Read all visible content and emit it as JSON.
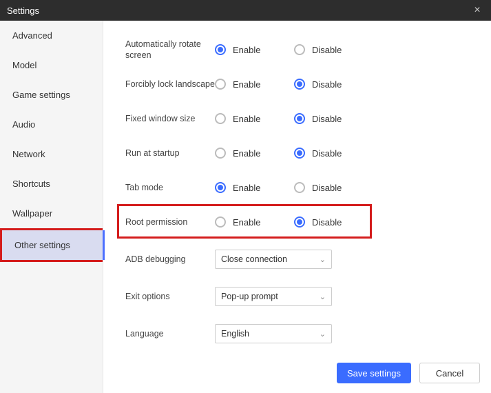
{
  "window": {
    "title": "Settings"
  },
  "sidebar": {
    "items": [
      {
        "label": "Advanced"
      },
      {
        "label": "Model"
      },
      {
        "label": "Game settings"
      },
      {
        "label": "Audio"
      },
      {
        "label": "Network"
      },
      {
        "label": "Shortcuts"
      },
      {
        "label": "Wallpaper"
      },
      {
        "label": "Other settings"
      }
    ],
    "active_index": 7
  },
  "settings": {
    "rows": [
      {
        "label": "Automatically rotate screen",
        "enable": "Enable",
        "disable": "Disable",
        "selected": "enable"
      },
      {
        "label": "Forcibly lock landscape",
        "enable": "Enable",
        "disable": "Disable",
        "selected": "disable"
      },
      {
        "label": "Fixed window size",
        "enable": "Enable",
        "disable": "Disable",
        "selected": "disable"
      },
      {
        "label": "Run at startup",
        "enable": "Enable",
        "disable": "Disable",
        "selected": "disable"
      },
      {
        "label": "Tab mode",
        "enable": "Enable",
        "disable": "Disable",
        "selected": "enable"
      },
      {
        "label": "Root permission",
        "enable": "Enable",
        "disable": "Disable",
        "selected": "disable",
        "highlighted": true
      }
    ],
    "adb": {
      "label": "ADB debugging",
      "value": "Close connection"
    },
    "exit": {
      "label": "Exit options",
      "value": "Pop-up prompt"
    },
    "language": {
      "label": "Language",
      "value": "English"
    }
  },
  "footer": {
    "save": "Save settings",
    "cancel": "Cancel"
  }
}
